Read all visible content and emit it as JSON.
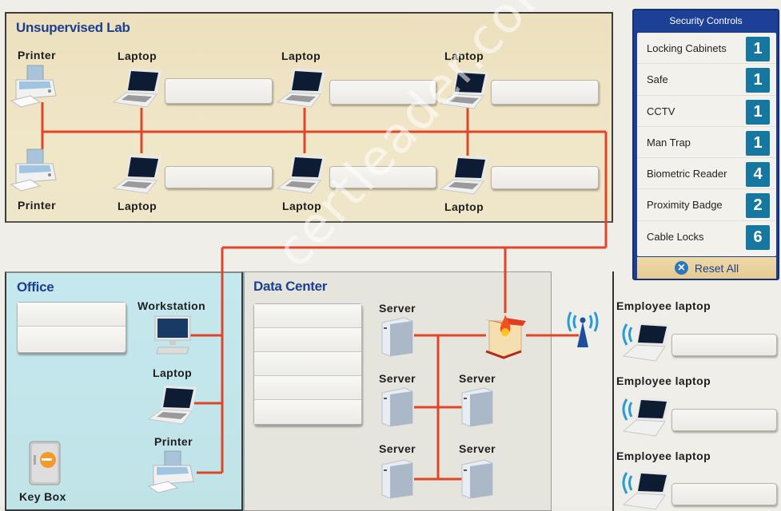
{
  "zones": {
    "lab": "Unsupervised Lab",
    "office": "Office",
    "datacenter": "Data Center"
  },
  "lab_devices": {
    "printer_top": "Printer",
    "printer_bottom": "Printer",
    "laptop_t1": "Laptop",
    "laptop_t2": "Laptop",
    "laptop_t3": "Laptop",
    "laptop_b1": "Laptop",
    "laptop_b2": "Laptop",
    "laptop_b3": "Laptop"
  },
  "office_devices": {
    "workstation": "Workstation",
    "laptop": "Laptop",
    "printer": "Printer",
    "keybox": "Key Box"
  },
  "dc_devices": {
    "server1": "Server",
    "server2": "Server",
    "server3": "Server",
    "server4": "Server",
    "server5": "Server"
  },
  "wireless_devices": {
    "emp1": "Employee laptop",
    "emp2": "Employee laptop",
    "emp3": "Employee laptop"
  },
  "security_controls": {
    "title": "Security Controls",
    "items": [
      {
        "label": "Locking Cabinets",
        "count": "1"
      },
      {
        "label": "Safe",
        "count": "1"
      },
      {
        "label": "CCTV",
        "count": "1"
      },
      {
        "label": "Man Trap",
        "count": "1"
      },
      {
        "label": "Biometric Reader",
        "count": "4"
      },
      {
        "label": "Proximity Badge",
        "count": "2"
      },
      {
        "label": "Cable Locks",
        "count": "6"
      }
    ],
    "reset_label": "Reset All"
  },
  "watermark": "certleader.com",
  "colors": {
    "wire": "#e0452a",
    "panel_blue": "#1d3f95",
    "count_badge": "#1677a1",
    "zone_title": "#1c3f8f"
  }
}
